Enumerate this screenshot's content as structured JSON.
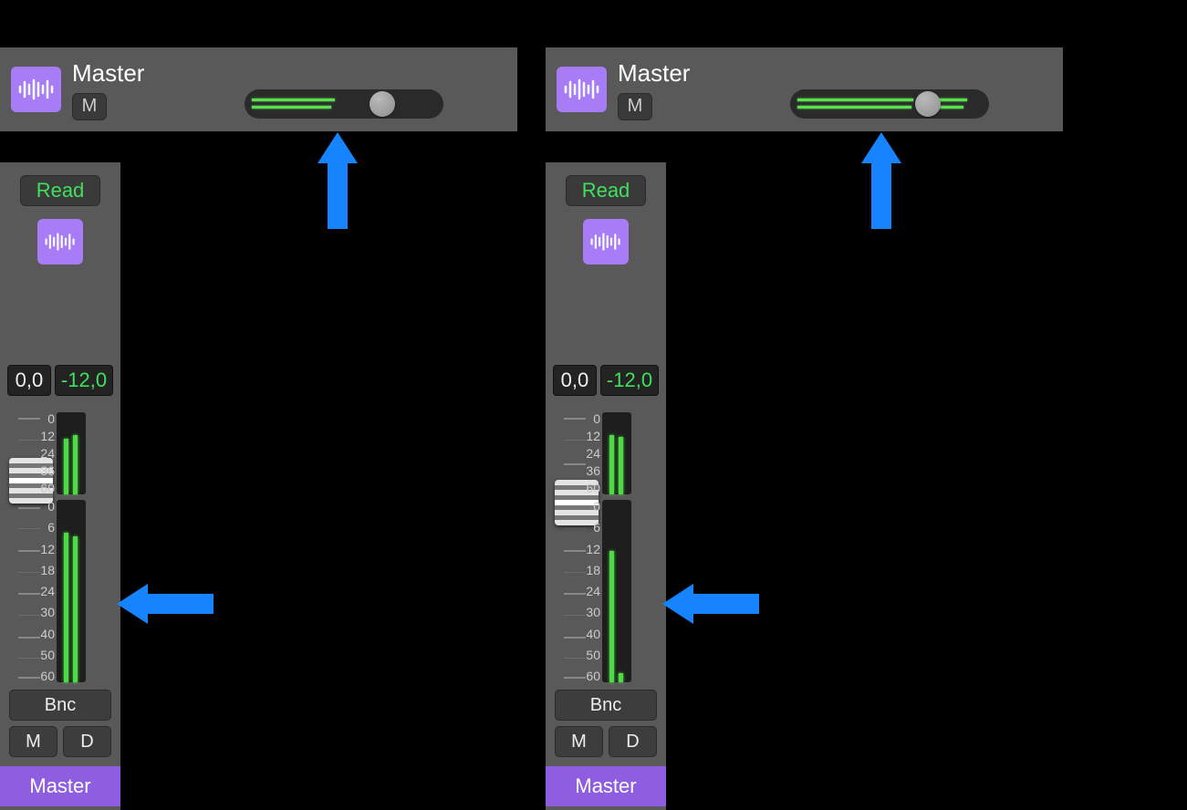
{
  "left": {
    "trackHeader": {
      "name": "Master",
      "mute": "M",
      "hSlider": {
        "thumbPct": 71,
        "meterTopPct": 45,
        "meterBotPct": 43
      }
    },
    "strip": {
      "automation": "Read",
      "gain": "0,0",
      "peak": "-12,0",
      "topMeter": {
        "labels": [
          "0",
          "12",
          "24",
          "36",
          "60"
        ],
        "l": 68,
        "r": 72
      },
      "bottomMeter": {
        "labels": [
          "0",
          "6",
          "12",
          "18",
          "24",
          "30",
          "40",
          "50",
          "60"
        ],
        "l": 82,
        "r": 80
      },
      "faderPosPct": 17,
      "bnc": "Bnc",
      "mute": "M",
      "dim": "D",
      "label": "Master"
    }
  },
  "right": {
    "trackHeader": {
      "name": "Master",
      "mute": "M",
      "hSlider": {
        "thumbPct": 71,
        "meterTopPct": 92,
        "meterBotPct": 90
      }
    },
    "strip": {
      "automation": "Read",
      "gain": "0,0",
      "peak": "-12,0",
      "topMeter": {
        "labels": [
          "0",
          "12",
          "24",
          "36",
          "60"
        ],
        "l": 72,
        "r": 70
      },
      "bottomMeter": {
        "labels": [
          "0",
          "6",
          "12",
          "18",
          "24",
          "30",
          "40",
          "50",
          "60"
        ],
        "l": 72,
        "r": 5
      },
      "faderPosPct": 25,
      "bnc": "Bnc",
      "mute": "M",
      "dim": "D",
      "label": "Master"
    }
  },
  "icons": {
    "waveform": "waveform-icon"
  }
}
